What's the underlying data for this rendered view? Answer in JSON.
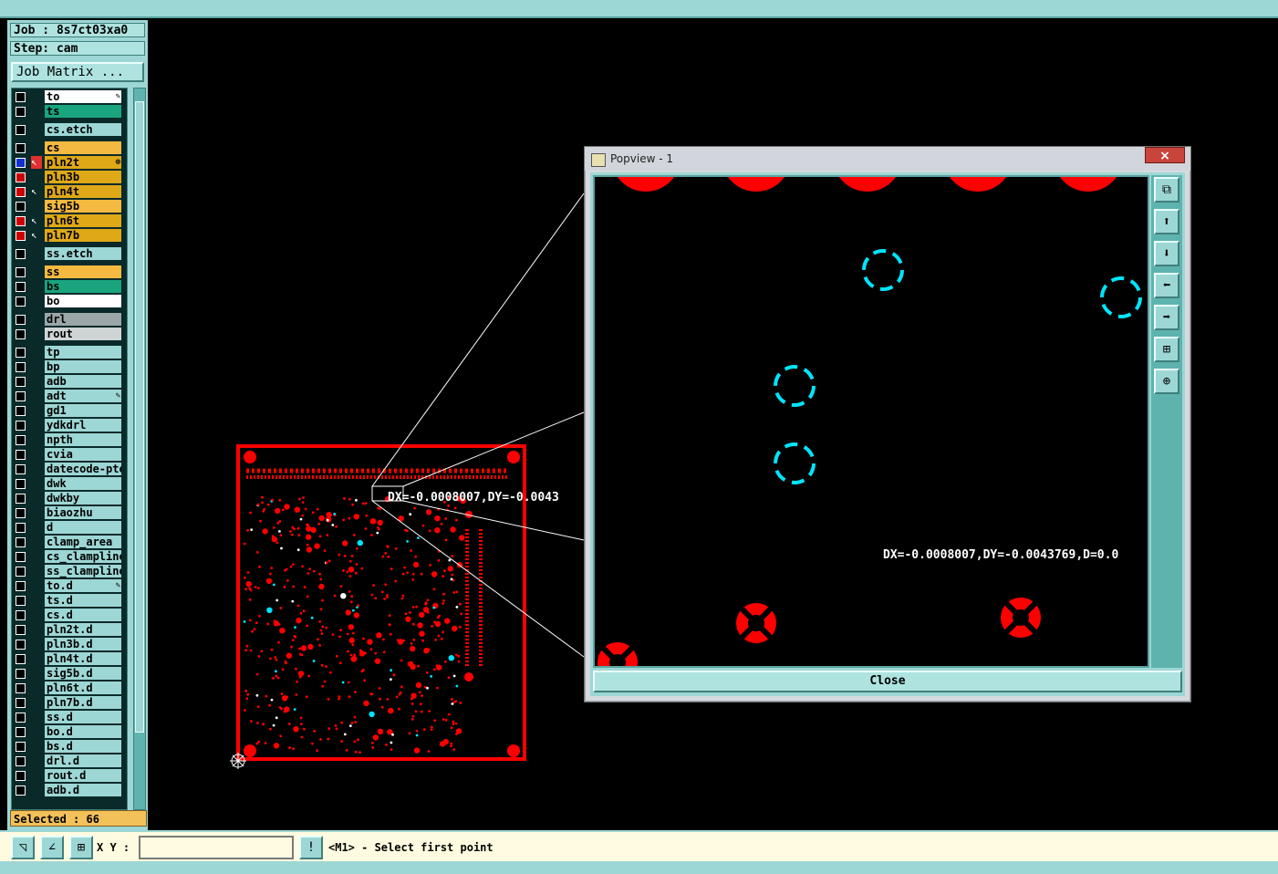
{
  "job_label": "Job : 8s7ct03xa0",
  "step_label": "Step: cam",
  "job_matrix_label": "Job Matrix ...",
  "layers": [
    {
      "name": "to",
      "color": "#ffffff",
      "mark": "✎"
    },
    {
      "name": "ts",
      "color": "#1aa57f"
    },
    {
      "name": "cs.etch",
      "color": "#9dd7d5"
    },
    {
      "name": "cs",
      "color": "#f4b940"
    },
    {
      "name": "pln2t",
      "color": "#dfa817",
      "checked": "blue",
      "arrow": "red",
      "mark": "⊕"
    },
    {
      "name": "pln3b",
      "color": "#dfa817",
      "checked": "red"
    },
    {
      "name": "pln4t",
      "color": "#dfa817",
      "checked": "red",
      "arrow": "white"
    },
    {
      "name": "sig5b",
      "color": "#f4b940"
    },
    {
      "name": "pln6t",
      "color": "#dfa817",
      "checked": "red",
      "arrow": "white"
    },
    {
      "name": "pln7b",
      "color": "#dfa817",
      "checked": "red",
      "arrow": "white"
    },
    {
      "name": "ss.etch",
      "color": "#9dd7d5"
    },
    {
      "name": "ss",
      "color": "#f4b940"
    },
    {
      "name": "bs",
      "color": "#1aa57f"
    },
    {
      "name": "bo",
      "color": "#ffffff"
    },
    {
      "name": "drl",
      "color": "#9aa6a8"
    },
    {
      "name": "rout",
      "color": "#cfd4d4"
    },
    {
      "name": "tp",
      "color": "#9dd7d5"
    },
    {
      "name": "bp",
      "color": "#9dd7d5"
    },
    {
      "name": "adb",
      "color": "#9dd7d5"
    },
    {
      "name": "adt",
      "color": "#9dd7d5",
      "mark": "✎"
    },
    {
      "name": "gd1",
      "color": "#9dd7d5"
    },
    {
      "name": "ydkdrl",
      "color": "#9dd7d5"
    },
    {
      "name": "npth",
      "color": "#9dd7d5"
    },
    {
      "name": "cvia",
      "color": "#9dd7d5"
    },
    {
      "name": "datecode-pte",
      "color": "#9dd7d5"
    },
    {
      "name": "dwk",
      "color": "#9dd7d5"
    },
    {
      "name": "dwkby",
      "color": "#9dd7d5"
    },
    {
      "name": "biaozhu",
      "color": "#9dd7d5"
    },
    {
      "name": "d",
      "color": "#9dd7d5"
    },
    {
      "name": "clamp_area",
      "color": "#9dd7d5"
    },
    {
      "name": "cs_clampline",
      "color": "#9dd7d5"
    },
    {
      "name": "ss_clampline",
      "color": "#9dd7d5"
    },
    {
      "name": "to.d",
      "color": "#9dd7d5",
      "mark": "✎"
    },
    {
      "name": "ts.d",
      "color": "#9dd7d5"
    },
    {
      "name": "cs.d",
      "color": "#9dd7d5"
    },
    {
      "name": "pln2t.d",
      "color": "#9dd7d5"
    },
    {
      "name": "pln3b.d",
      "color": "#9dd7d5"
    },
    {
      "name": "pln4t.d",
      "color": "#9dd7d5"
    },
    {
      "name": "sig5b.d",
      "color": "#9dd7d5"
    },
    {
      "name": "pln6t.d",
      "color": "#9dd7d5"
    },
    {
      "name": "pln7b.d",
      "color": "#9dd7d5"
    },
    {
      "name": "ss.d",
      "color": "#9dd7d5"
    },
    {
      "name": "bo.d",
      "color": "#9dd7d5"
    },
    {
      "name": "bs.d",
      "color": "#9dd7d5"
    },
    {
      "name": "drl.d",
      "color": "#9dd7d5"
    },
    {
      "name": "rout.d",
      "color": "#9dd7d5"
    },
    {
      "name": "adb.d",
      "color": "#9dd7d5"
    }
  ],
  "selected_label": "Selected : 66",
  "xy_label": "X Y :",
  "xy_value": "",
  "prompt_text": "<M1> - Select first point",
  "measure_text_main": "DX=-0.0008007,DY=-0.0043",
  "popview": {
    "title": "Popview - 1",
    "close_x": "×",
    "close_label": "Close",
    "measure_text": "DX=-0.0008007,DY=-0.0043769,D=0.0"
  },
  "colors": {
    "panel": "#9dd7d5",
    "board": "#ff0000",
    "via": "#00e5ff"
  }
}
